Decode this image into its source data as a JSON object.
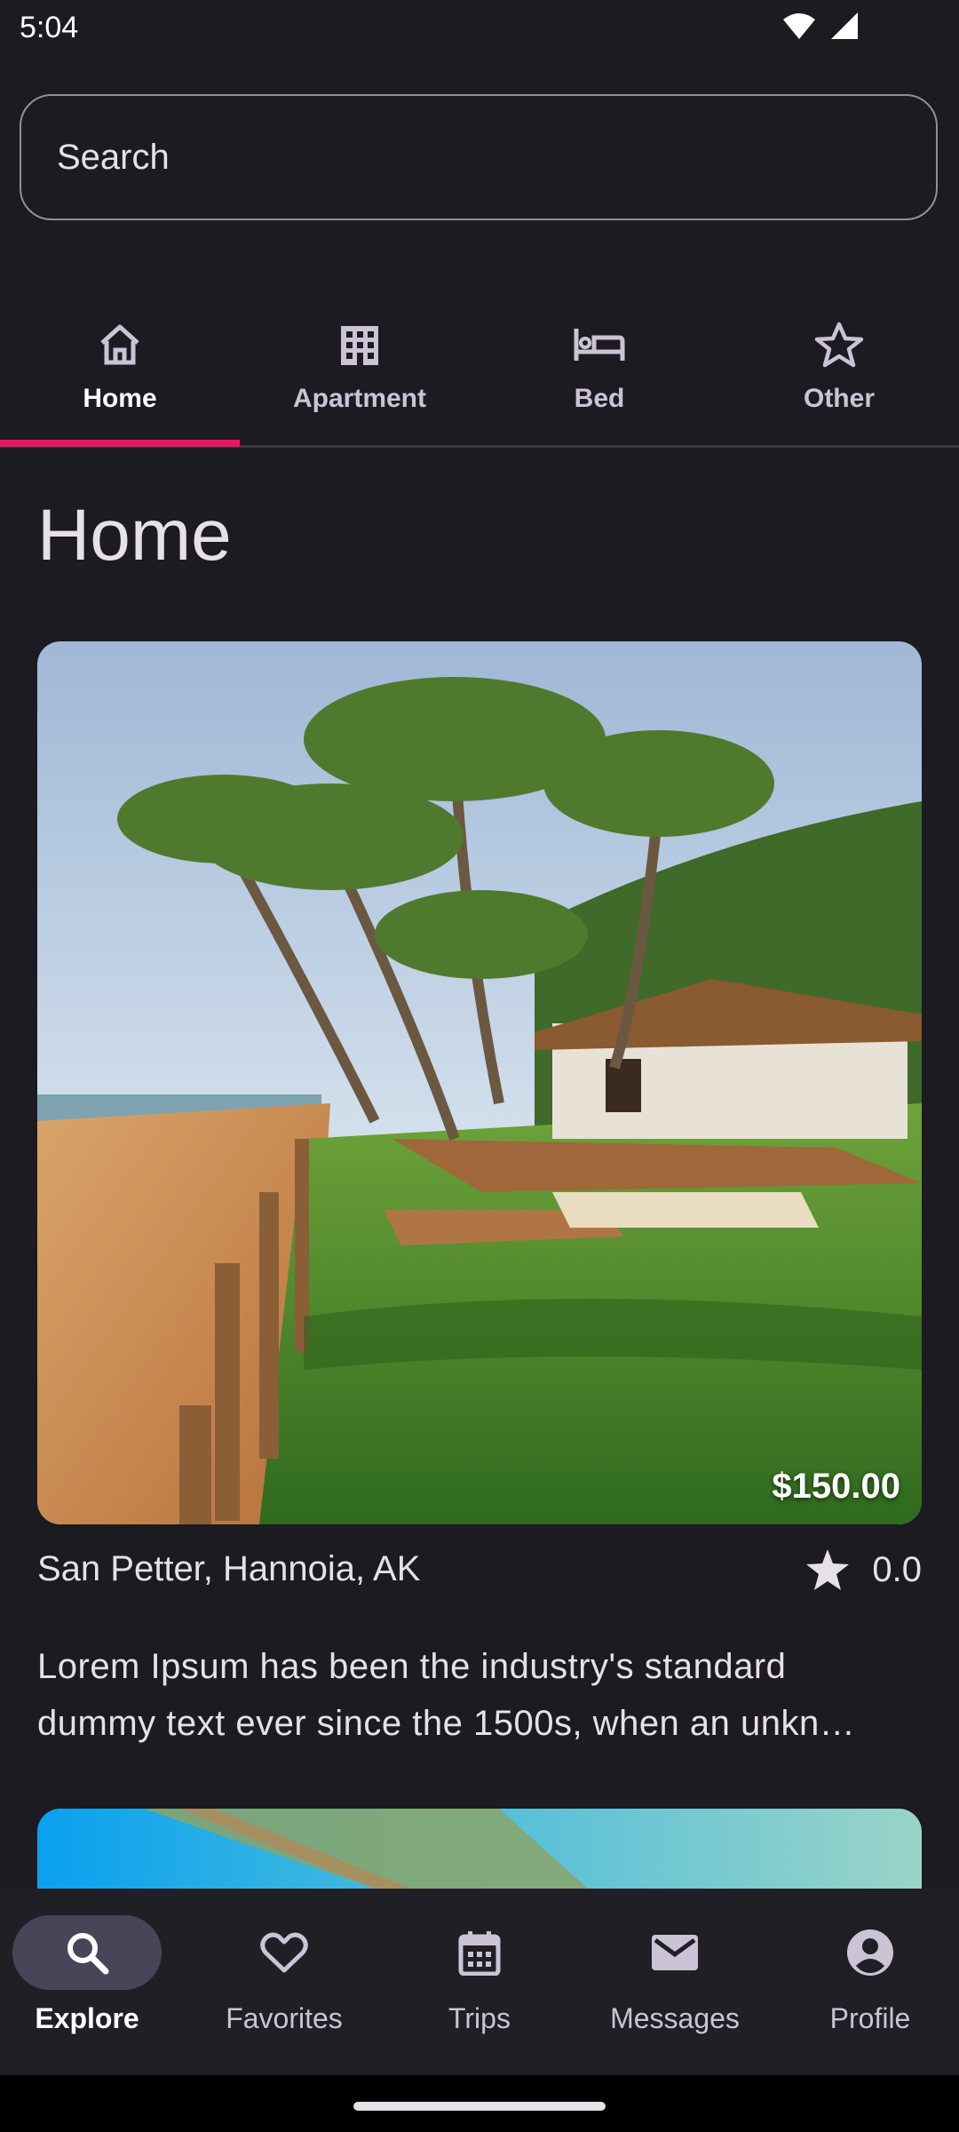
{
  "status": {
    "time": "5:04"
  },
  "search": {
    "placeholder": "Search"
  },
  "tabs": [
    {
      "label": "Home",
      "icon": "home-icon",
      "active": true
    },
    {
      "label": "Apartment",
      "icon": "apartment-icon",
      "active": false
    },
    {
      "label": "Bed",
      "icon": "bed-icon",
      "active": false
    },
    {
      "label": "Other",
      "icon": "star-outline-icon",
      "active": false
    }
  ],
  "page": {
    "title": "Home"
  },
  "listing": {
    "price": "$150.00",
    "location": "San Petter, Hannoia, AK",
    "rating": "0.0",
    "description_line1": "Lorem Ipsum has been the industry's standard",
    "description_line2": "dummy text ever since the 1500s, when an unkn…"
  },
  "bottom_nav": [
    {
      "label": "Explore",
      "icon": "search-icon",
      "active": true
    },
    {
      "label": "Favorites",
      "icon": "heart-icon",
      "active": false
    },
    {
      "label": "Trips",
      "icon": "calendar-icon",
      "active": false
    },
    {
      "label": "Messages",
      "icon": "mail-icon",
      "active": false
    },
    {
      "label": "Profile",
      "icon": "account-icon",
      "active": false
    }
  ],
  "colors": {
    "background": "#1c1b21",
    "accent": "#e8175d",
    "nav_active_pill": "#4a4458"
  }
}
